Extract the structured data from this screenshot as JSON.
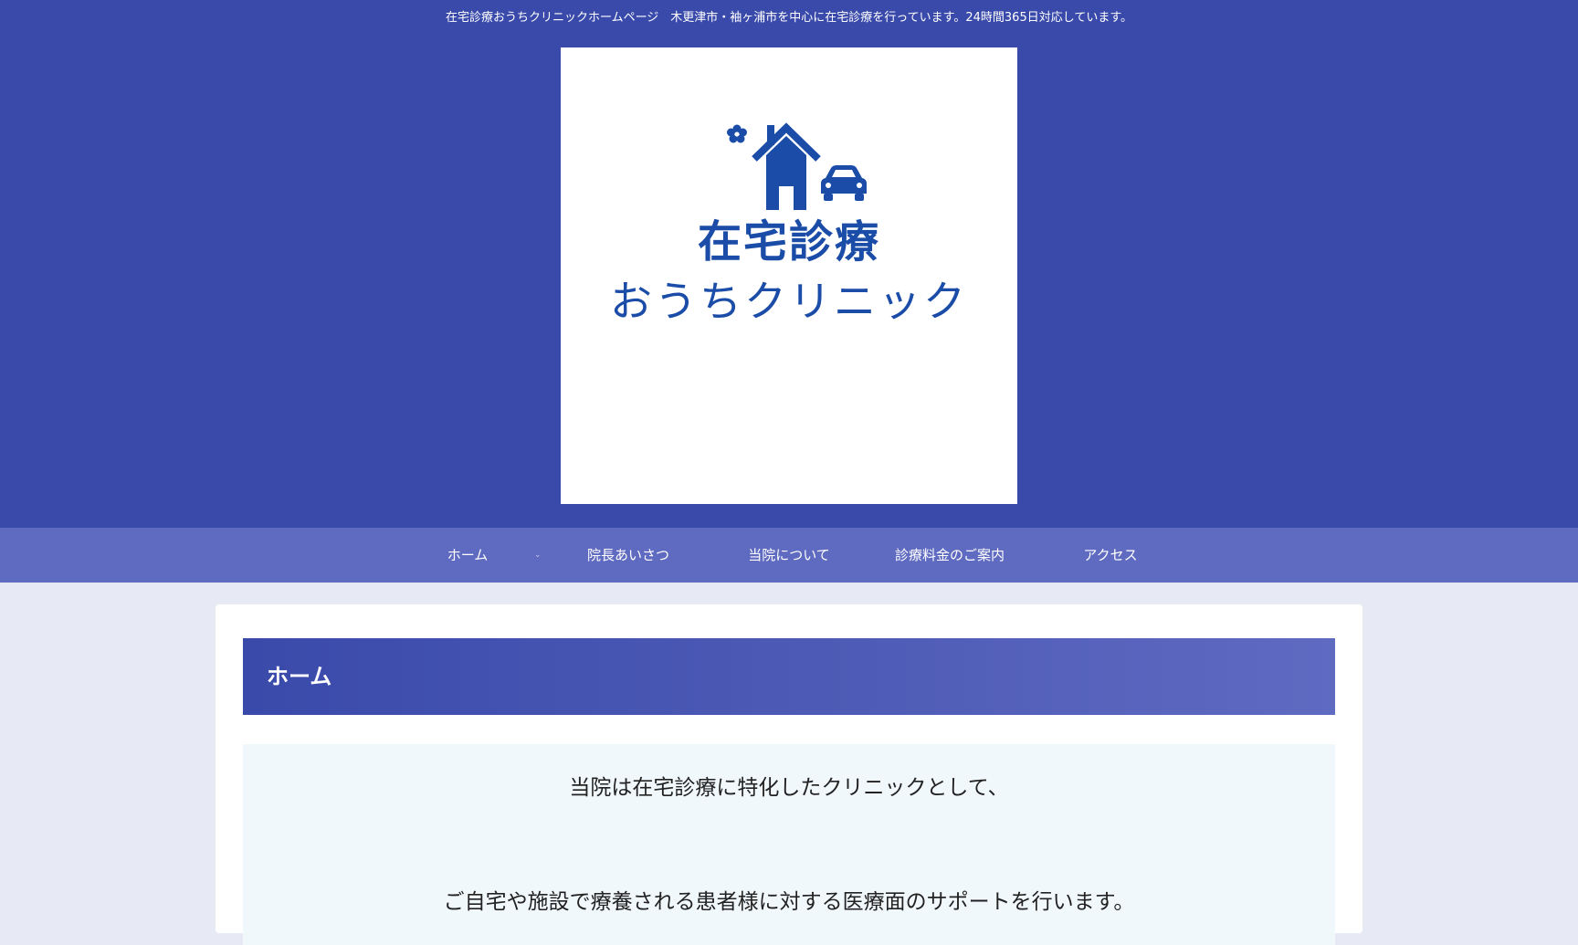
{
  "header": {
    "tagline": "在宅診療おうちクリニックホームページ　木更津市・袖ヶ浦市を中心に在宅診療を行っています。24時間365日対応しています。",
    "logo": {
      "line1": "在宅診療",
      "line2": "おうちクリニック",
      "icons": [
        "flower-icon",
        "house-icon",
        "car-icon"
      ],
      "color": "#1a4ca8"
    },
    "background_color": "#3a4aaa"
  },
  "nav": {
    "background_color": "#5f6ac1",
    "items": [
      {
        "label": "ホーム"
      },
      {
        "label": "院長あいさつ"
      },
      {
        "label": "当院について"
      },
      {
        "label": "診療料金のご案内"
      },
      {
        "label": "アクセス"
      }
    ],
    "dropdown_icon": "chevron-down-icon"
  },
  "main": {
    "page_title": "ホーム",
    "intro_lines": [
      "当院は在宅診療に特化したクリニックとして、",
      "ご自宅や施設で療養される患者様に対する医療面のサポートを行います。"
    ],
    "intro_background": "#f1f8fc"
  }
}
